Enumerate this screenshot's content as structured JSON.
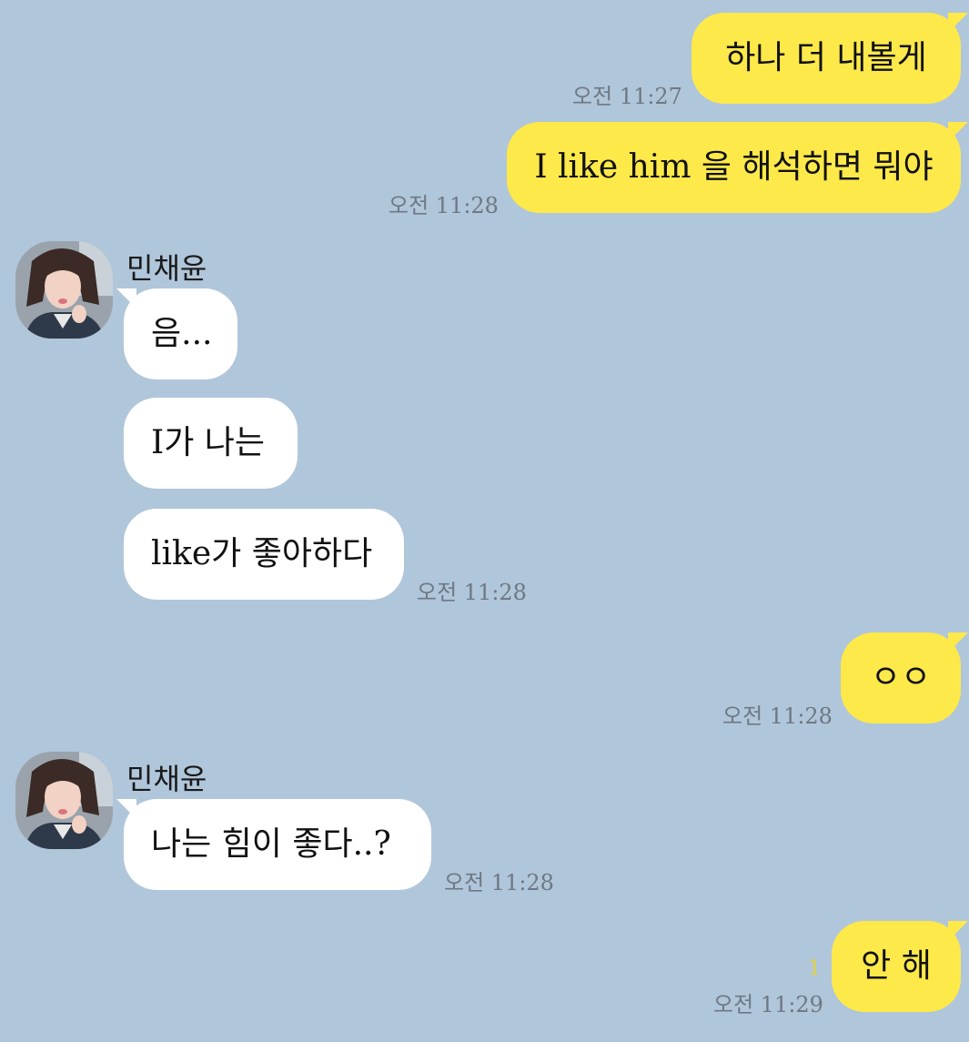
{
  "chat": {
    "contact_name": "민채윤",
    "messages": [
      {
        "from": "me",
        "text": "하나 더 내볼게",
        "time": "오전 11:27"
      },
      {
        "from": "me",
        "text": "I like him 을 해석하면 뭐야",
        "time": "오전 11:28"
      },
      {
        "from": "them",
        "text": "음...",
        "time": ""
      },
      {
        "from": "them",
        "text": "I가 나는",
        "time": ""
      },
      {
        "from": "them",
        "text": "like가 좋아하다",
        "time": "오전 11:28"
      },
      {
        "from": "me",
        "text": "ㅇㅇ",
        "time": "오전 11:28"
      },
      {
        "from": "them",
        "text": "나는 힘이 좋다..?",
        "time": "오전 11:28"
      },
      {
        "from": "me",
        "text": "안 해",
        "time": "오전 11:29",
        "unread_count": "1"
      }
    ]
  },
  "colors": {
    "background": "#b0c6da",
    "my_bubble": "#fee94a",
    "their_bubble": "#ffffff",
    "time_text": "#6e7884",
    "unread_count": "#e8d23a"
  }
}
